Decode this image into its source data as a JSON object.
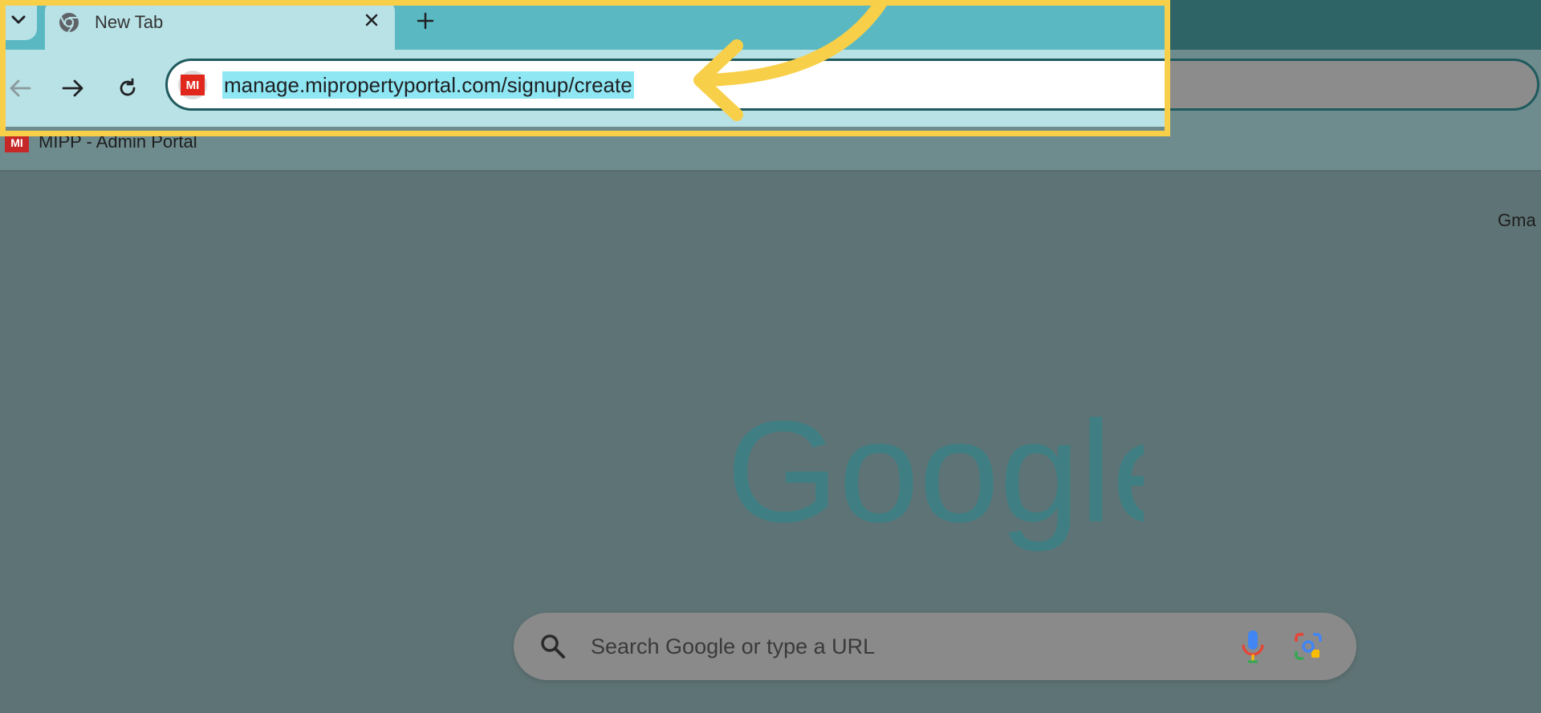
{
  "browser": {
    "tab": {
      "title": "New Tab"
    },
    "omnibox": {
      "url": "manage.mipropertyportal.com/signup/create",
      "site_badge": "MI"
    },
    "bookmarks": [
      {
        "label": "MIPP - Admin Portal",
        "badge": "MI"
      }
    ]
  },
  "new_tab_page": {
    "gmail_link": "Gma",
    "logo": "Google",
    "search": {
      "placeholder": "Search Google or type a URL"
    }
  },
  "colors": {
    "annotation": "#f8cf48",
    "url_selection": "#8ee7f3",
    "site_badge": "#e1261c"
  },
  "icons": [
    "chevron-down-icon",
    "chrome-icon",
    "close-icon",
    "plus-icon",
    "back-arrow-icon",
    "forward-arrow-icon",
    "reload-icon",
    "search-icon",
    "mic-icon",
    "google-lens-icon"
  ]
}
